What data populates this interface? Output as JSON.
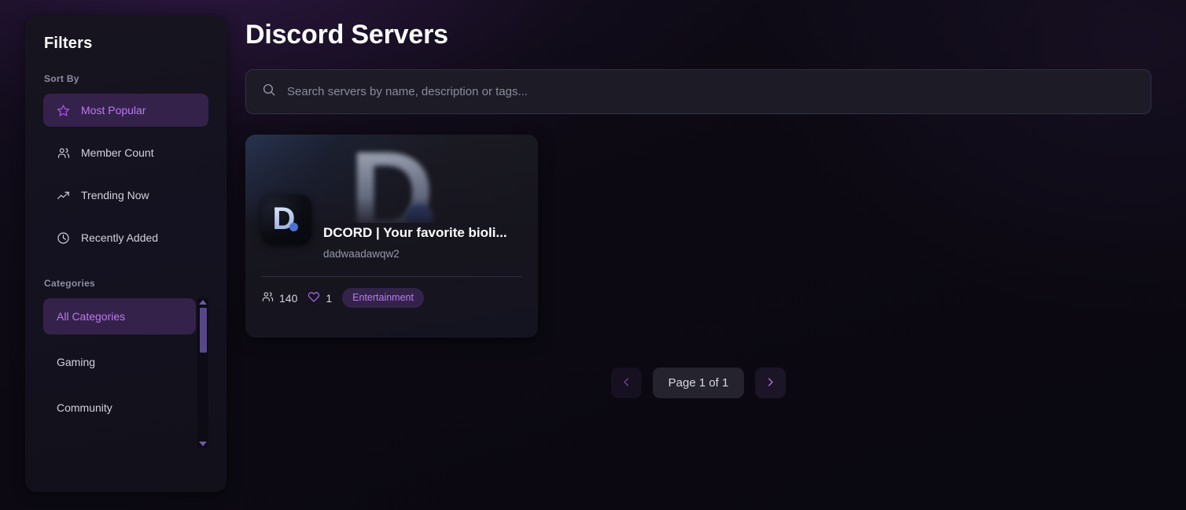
{
  "header": {
    "title": "Discord Servers"
  },
  "search": {
    "placeholder": "Search servers by name, description or tags...",
    "value": "",
    "icon": "search-icon"
  },
  "sidebar": {
    "title": "Filters",
    "sort": {
      "label": "Sort By",
      "items": [
        {
          "label": "Most Popular",
          "icon": "star-icon",
          "active": true
        },
        {
          "label": "Member Count",
          "icon": "users-icon",
          "active": false
        },
        {
          "label": "Trending Now",
          "icon": "trending-up-icon",
          "active": false
        },
        {
          "label": "Recently Added",
          "icon": "clock-icon",
          "active": false
        }
      ]
    },
    "categories": {
      "label": "Categories",
      "items": [
        {
          "label": "All Categories",
          "active": true
        },
        {
          "label": "Gaming",
          "active": false
        },
        {
          "label": "Community",
          "active": false
        }
      ]
    }
  },
  "servers": [
    {
      "banner_letter": "D",
      "avatar_letter": "D",
      "name": "DCORD | Your favorite bioli...",
      "handle": "dadwaadawqw2",
      "members": "140",
      "likes": "1",
      "tag": "Entertainment"
    }
  ],
  "pagination": {
    "prev_icon": "chevron-left-icon",
    "next_icon": "chevron-right-icon",
    "label": "Page 1 of 1"
  },
  "colors": {
    "accent": "#a855f7",
    "accent_text": "#b97af0",
    "active_bg": "#35224a",
    "page_bg": "#0a0811",
    "panel_bg": "#16131f",
    "card_bg": "#17161f"
  }
}
